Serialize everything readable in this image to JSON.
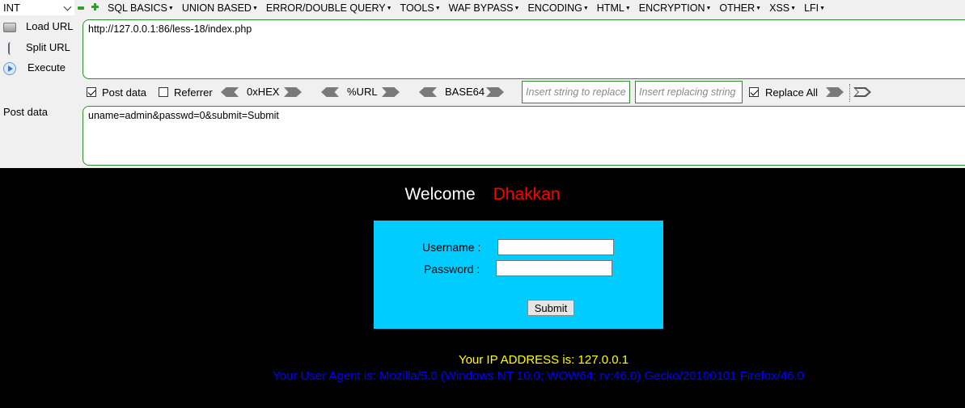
{
  "hackbar": {
    "type_select": "INT",
    "menus": [
      "SQL BASICS",
      "UNION BASED",
      "ERROR/DOUBLE QUERY",
      "TOOLS",
      "WAF BYPASS",
      "ENCODING",
      "HTML",
      "ENCRYPTION",
      "OTHER",
      "XSS",
      "LFI"
    ],
    "actions": {
      "load_url": "Load URL",
      "split_url": "Split URL",
      "execute": "Execute"
    },
    "url_value": "http://127.0.0.1:86/less-18/index.php",
    "toolbar": {
      "post_data_label": "Post data",
      "post_data_checked": true,
      "referrer_label": "Referrer",
      "referrer_checked": false,
      "hex_label": "0xHEX",
      "url_label": "%URL",
      "base64_label": "BASE64",
      "insert_placeholder": "Insert string to replace",
      "replacing_placeholder": "Insert replacing string",
      "replace_all_label": "Replace All",
      "replace_all_checked": true
    },
    "post_label": "Post data",
    "post_value": "uname=admin&passwd=0&submit=Submit"
  },
  "page": {
    "welcome": "Welcome",
    "name": "Dhakkan",
    "form": {
      "username_label": "Username :",
      "password_label": "Password :",
      "submit_label": "Submit"
    },
    "ip_line": "Your IP ADDRESS is: 127.0.0.1",
    "ua_line": "Your User Agent is: Mozilla/5.0 (Windows NT 10.0; WOW64; rv:46.0) Gecko/20100101 Firefox/46.0"
  },
  "colors": {
    "accent_green": "#2e8b2e",
    "form_bg": "#00ccff",
    "welcome_name": "#ff0000",
    "ip_text": "#ffff00",
    "ua_text": "#0000ff"
  }
}
